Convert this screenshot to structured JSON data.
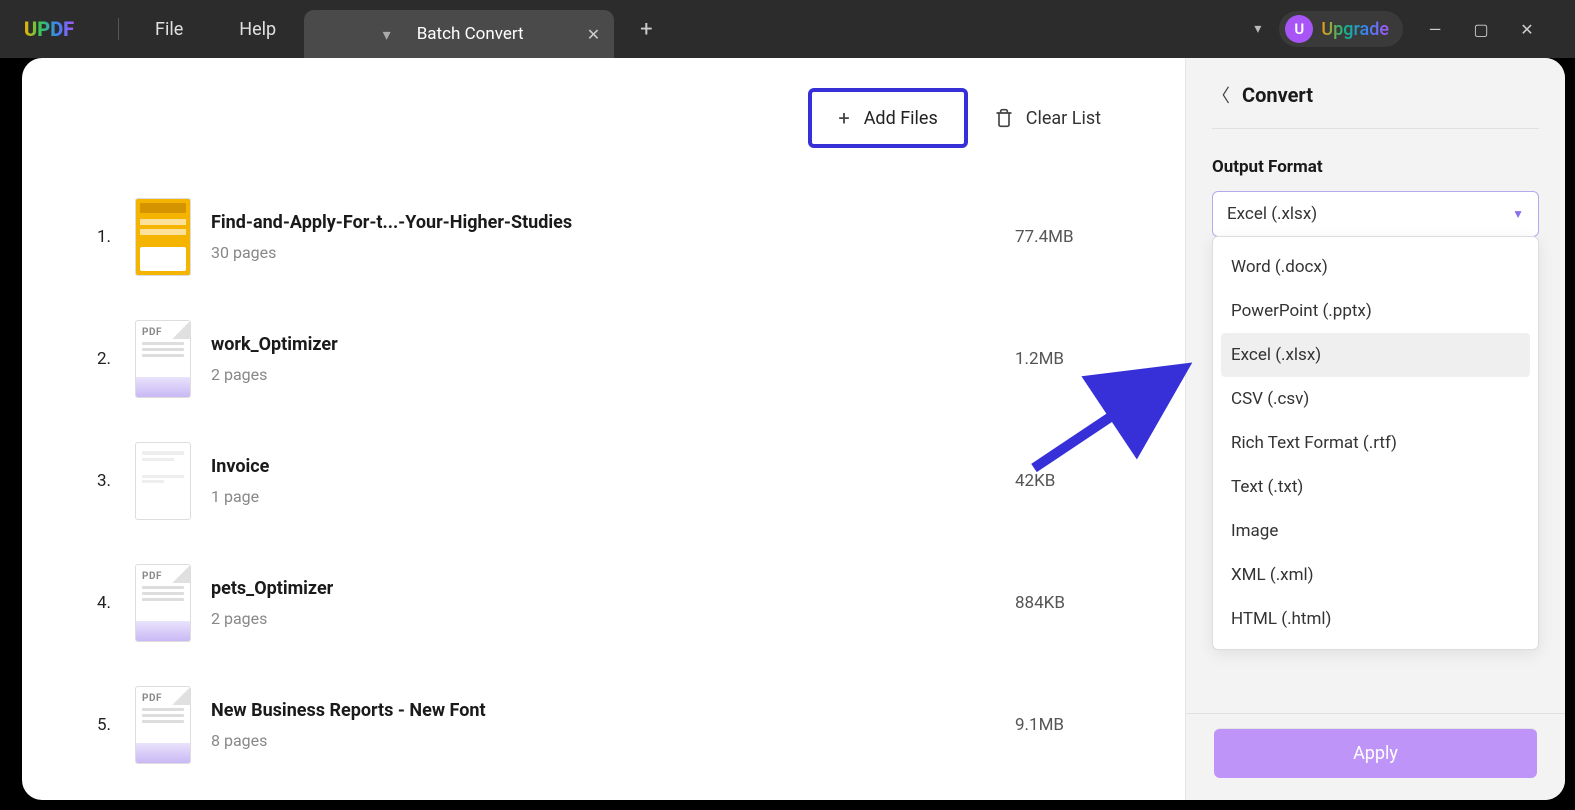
{
  "topbar": {
    "logo_text": "UPDF",
    "menu": {
      "file": "File",
      "help": "Help"
    },
    "tab": {
      "title": "Batch Convert"
    },
    "upgrade": {
      "avatar_letter": "U",
      "label": "Upgrade"
    }
  },
  "actions": {
    "add_files": "Add Files",
    "clear_list": "Clear List"
  },
  "files": [
    {
      "index": "1.",
      "name": "Find-and-Apply-For-t...-Your-Higher-Studies",
      "pages": "30 pages",
      "size": "77.4MB",
      "thumb": "yellow"
    },
    {
      "index": "2.",
      "name": "work_Optimizer",
      "pages": "2 pages",
      "size": "1.2MB",
      "thumb": "pdf"
    },
    {
      "index": "3.",
      "name": "Invoice",
      "pages": "1 page",
      "size": "42KB",
      "thumb": "blank"
    },
    {
      "index": "4.",
      "name": "pets_Optimizer",
      "pages": "2 pages",
      "size": "884KB",
      "thumb": "pdf"
    },
    {
      "index": "5.",
      "name": "New Business Reports - New Font",
      "pages": "8 pages",
      "size": "9.1MB",
      "thumb": "pdf"
    }
  ],
  "sidebar": {
    "title": "Convert",
    "output_format_label": "Output Format",
    "selected": "Excel (.xlsx)",
    "options": [
      "Word (.docx)",
      "PowerPoint (.pptx)",
      "Excel (.xlsx)",
      "CSV (.csv)",
      "Rich Text Format (.rtf)",
      "Text (.txt)",
      "Image",
      "XML (.xml)",
      "HTML (.html)"
    ],
    "apply": "Apply"
  }
}
